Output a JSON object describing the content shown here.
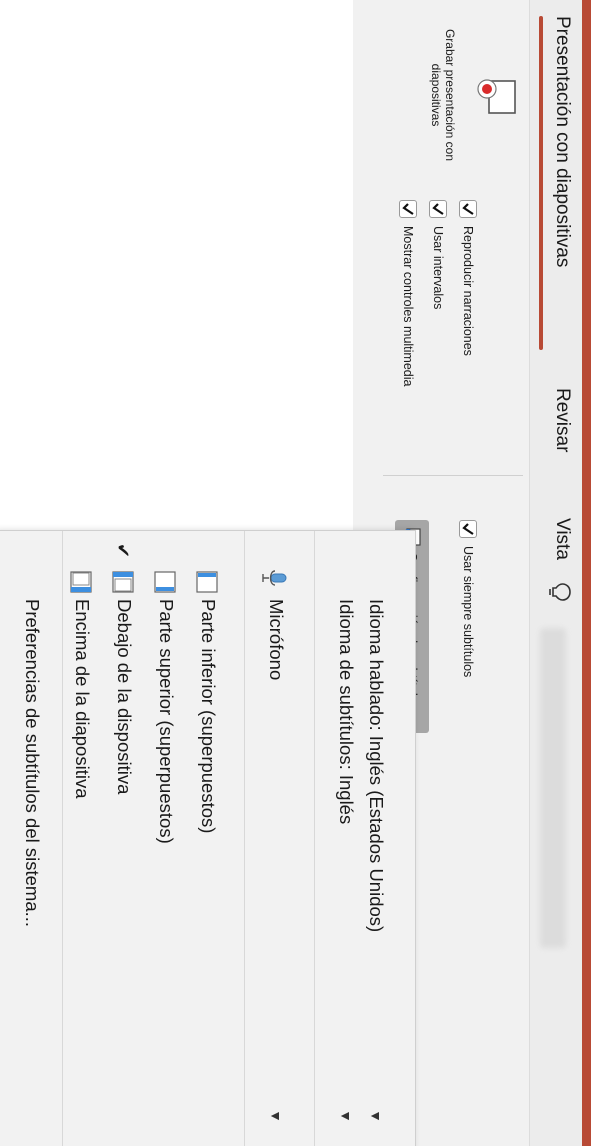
{
  "ribbon": {
    "tabs": [
      "Presentación con diapositivas",
      "Revisar",
      "Vista"
    ],
    "record_label": "Grabar presentación con diapositivas",
    "checkboxes": [
      {
        "label": "Reproducir narraciones",
        "checked": true
      },
      {
        "label": "Usar intervalos",
        "checked": true
      },
      {
        "label": "Mostrar controles multimedia",
        "checked": true
      }
    ],
    "subtitles_always": {
      "label": "Usar siempre subtítulos",
      "checked": true
    },
    "subtitle_settings_label": "Configuración de subtítulos",
    "accent_color": "#b84a35",
    "icons": {
      "lightbulb": "lightbulb-icon",
      "record": "record-slideshow-icon",
      "settings": "subtitle-settings-icon"
    }
  },
  "menu": {
    "spoken_language": "Idioma hablado: Inglés (Estados Unidos)",
    "subtitle_language": "Idioma de subtítulos: Inglés",
    "microphone": "Micrófono",
    "positions": [
      {
        "label": "Parte inferior (superpuestos)",
        "selected": false
      },
      {
        "label": "Parte superior (superpuestos)",
        "selected": false
      },
      {
        "label": "Debajo de la dispositiva",
        "selected": true
      },
      {
        "label": "Encima de la diapositiva",
        "selected": false
      }
    ],
    "system_preferences": "Preferencias de subtítulos del sistema...",
    "check_glyph": "✔",
    "arrow_glyph": "▼"
  }
}
